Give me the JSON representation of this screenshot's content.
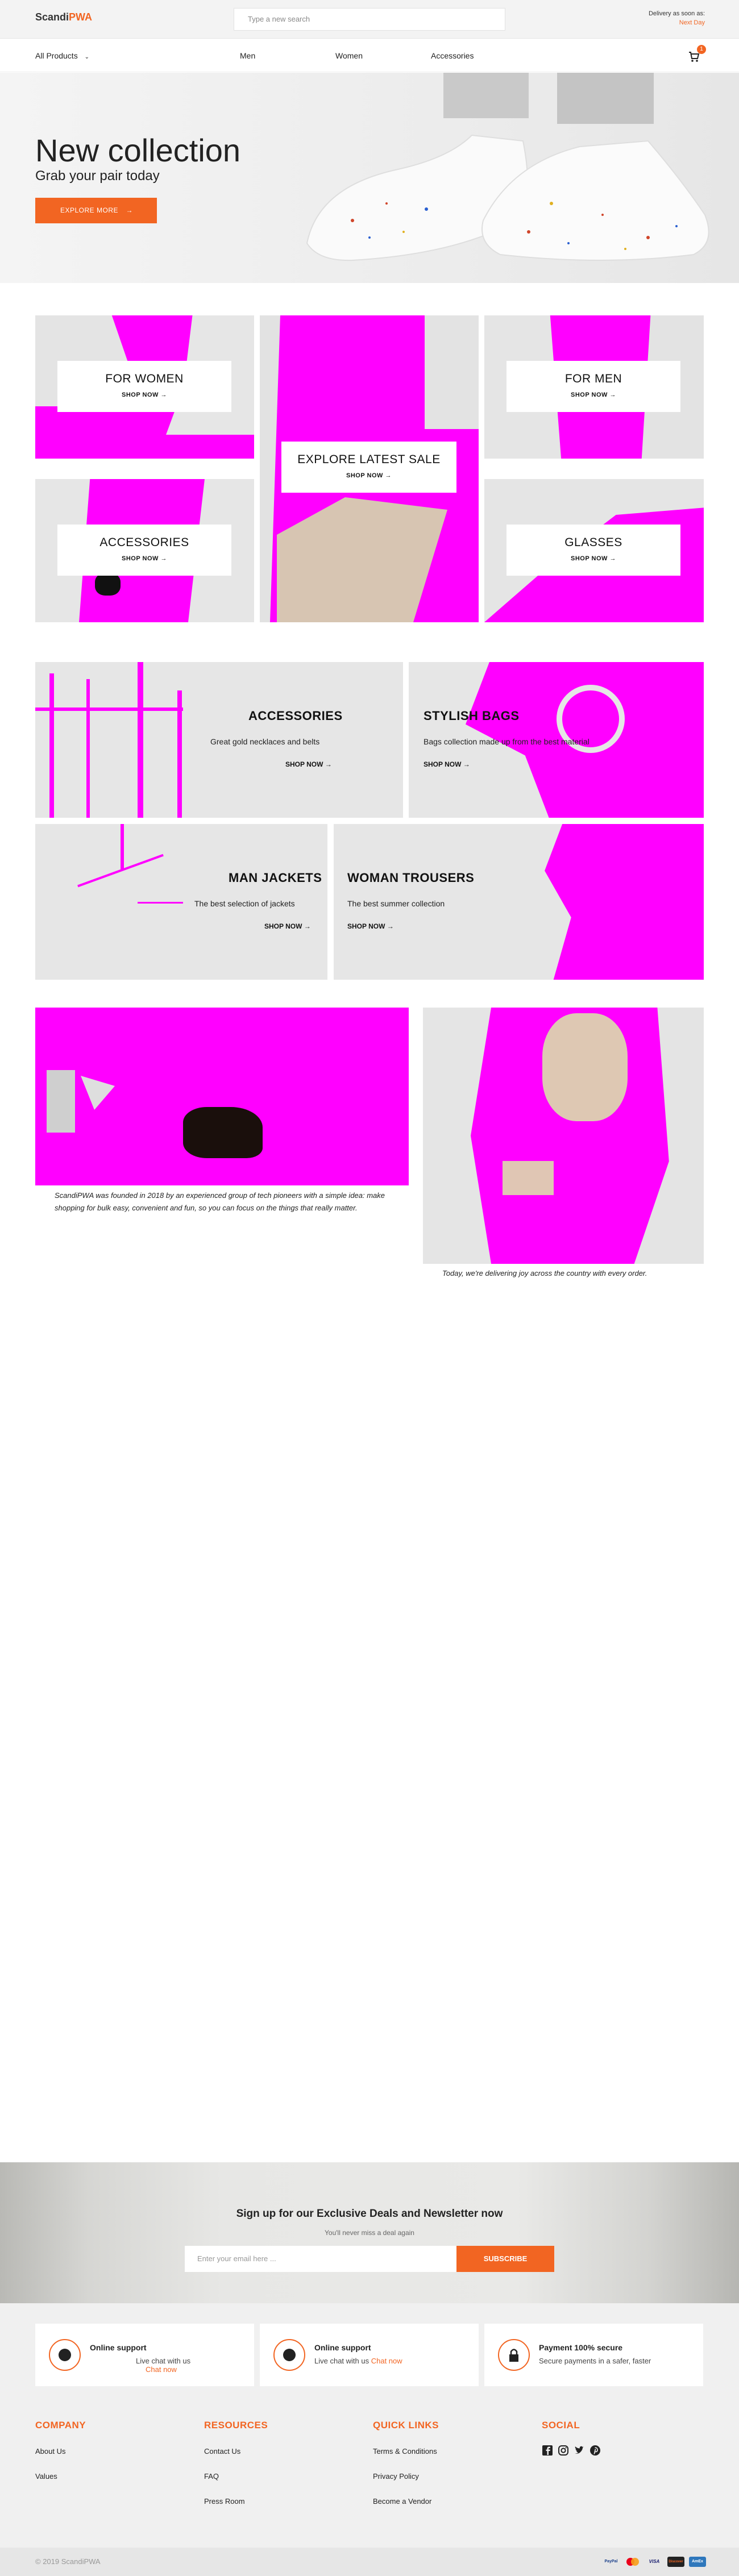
{
  "header": {
    "logo_main": "Scandi",
    "logo_accent": "PWA",
    "search_placeholder": "Type a new search",
    "delivery_label": "Delivery as soon as:",
    "delivery_value": "Next Day"
  },
  "nav": {
    "all_products": "All Products",
    "items": [
      "Men",
      "Women",
      "Accessories"
    ],
    "cart_count": "1"
  },
  "hero": {
    "title": "New collection",
    "subtitle": "Grab your pair today",
    "button": "EXPLORE MORE"
  },
  "categories": {
    "shop_now": "SHOP NOW",
    "women": "FOR WOMEN",
    "men": "FOR MEN",
    "accessories": "ACCESSORIES",
    "glasses": "GLASSES",
    "sale": "EXPLORE LATEST SALE"
  },
  "promos": [
    {
      "title": "ACCESSORIES",
      "desc": "Great gold necklaces and belts",
      "link": "SHOP NOW"
    },
    {
      "title": "STYLISH BAGS",
      "desc": "Bags collection made up from the best material",
      "link": "SHOP NOW"
    },
    {
      "title": "MAN JACKETS",
      "desc": "The best selection of jackets",
      "link": "SHOP NOW"
    },
    {
      "title": "WOMAN TROUSERS",
      "desc": "The best summer collection",
      "link": "SHOP NOW"
    }
  ],
  "story": {
    "caption1": "ScandiPWA was founded in 2018 by an experienced group of tech pioneers with a simple idea: make shopping for bulk easy, convenient and fun, so you can focus on the things that really matter.",
    "caption2": "Today, we're delivering joy across the country with every order."
  },
  "newsletter": {
    "title": "Sign up for our Exclusive Deals and Newsletter now",
    "subtitle": "You'll never miss a deal again",
    "placeholder": "Enter your email here ...",
    "button": "SUBSCRIBE"
  },
  "support": [
    {
      "title": "Online support",
      "text": "Live chat with us",
      "link": "Chat now"
    },
    {
      "title": "Online support",
      "text": "Live chat with us",
      "link": "Chat now"
    },
    {
      "title": "Payment 100% secure",
      "text": "Secure payments in a safer, faster",
      "link": ""
    }
  ],
  "footer": {
    "company": {
      "title": "COMPANY",
      "links": [
        "About Us",
        "Values"
      ]
    },
    "resources": {
      "title": "RESOURCES",
      "links": [
        "Contact Us",
        "FAQ",
        "Press Room"
      ]
    },
    "quick": {
      "title": "QUICK LINKS",
      "links": [
        "Terms & Conditions",
        "Privacy Policy",
        "Become a Vendor"
      ]
    },
    "social": {
      "title": "SOCIAL",
      "icons": [
        "facebook-icon",
        "instagram-icon",
        "twitter-icon",
        "pinterest-icon"
      ]
    },
    "copyright": "© 2019 ScandiPWA",
    "payments": [
      "PayPal",
      "Mastercard",
      "VISA",
      "Discover",
      "AmEx"
    ]
  },
  "colors": {
    "accent": "#f26522",
    "placeholder_magenta": "#ff00ff"
  }
}
